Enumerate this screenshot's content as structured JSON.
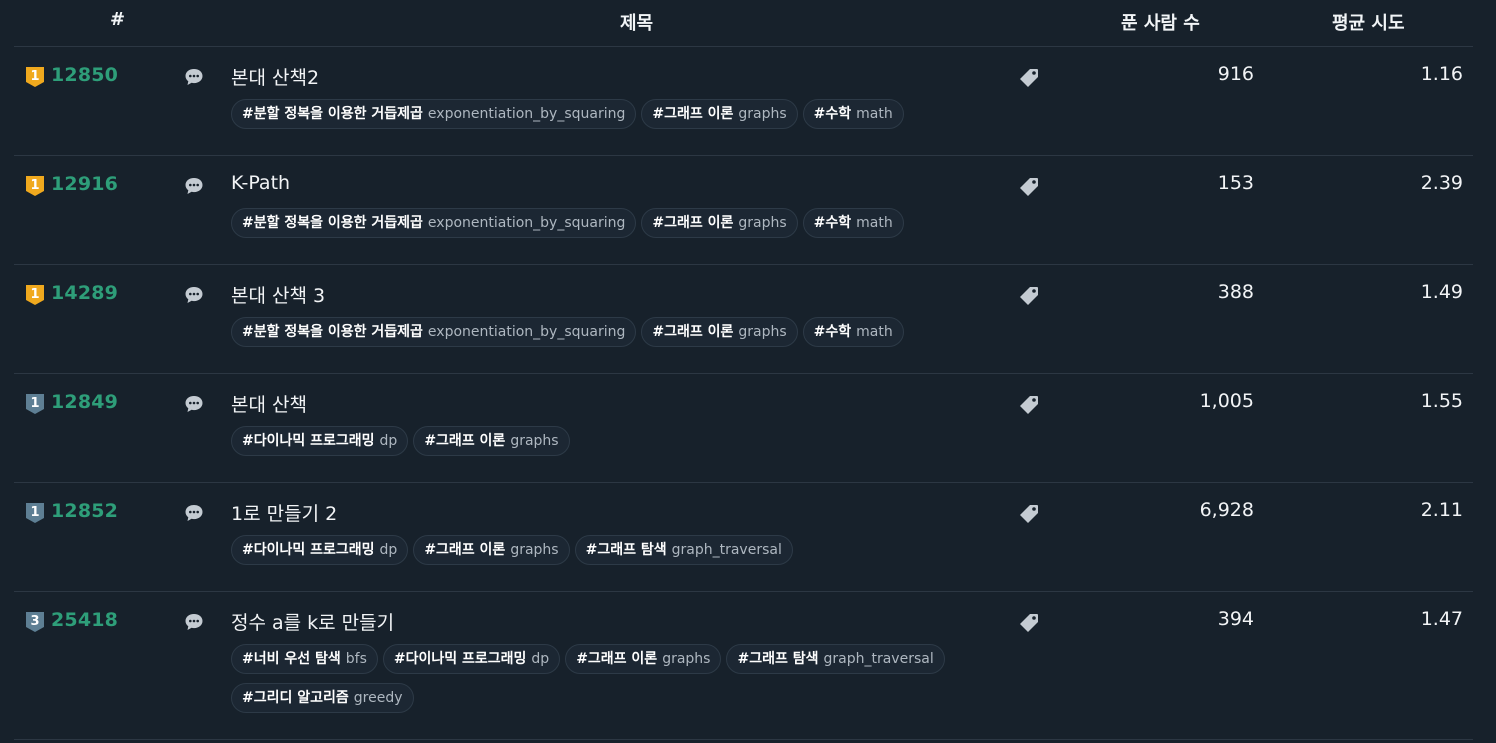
{
  "header": {
    "num": "#",
    "title": "제목",
    "solved": "푼 사람 수",
    "avg": "평균 시도"
  },
  "colors": {
    "gold": "#f0a91e",
    "silver": "#5e7f94",
    "id": "#2e9e79",
    "icon": "#c4cbd2"
  },
  "rows": [
    {
      "tier": "gold",
      "level": "1",
      "id": "12850",
      "title": "본대 산책2",
      "solved": "916",
      "avg": "1.16",
      "tags": [
        {
          "ko": "#분할 정복을 이용한 거듭제곱",
          "en": "exponentiation_by_squaring"
        },
        {
          "ko": "#그래프 이론",
          "en": "graphs"
        },
        {
          "ko": "#수학",
          "en": "math"
        }
      ]
    },
    {
      "tier": "gold",
      "level": "1",
      "id": "12916",
      "title": "K-Path",
      "solved": "153",
      "avg": "2.39",
      "tags": [
        {
          "ko": "#분할 정복을 이용한 거듭제곱",
          "en": "exponentiation_by_squaring"
        },
        {
          "ko": "#그래프 이론",
          "en": "graphs"
        },
        {
          "ko": "#수학",
          "en": "math"
        }
      ]
    },
    {
      "tier": "gold",
      "level": "1",
      "id": "14289",
      "title": "본대 산책 3",
      "solved": "388",
      "avg": "1.49",
      "tags": [
        {
          "ko": "#분할 정복을 이용한 거듭제곱",
          "en": "exponentiation_by_squaring"
        },
        {
          "ko": "#그래프 이론",
          "en": "graphs"
        },
        {
          "ko": "#수학",
          "en": "math"
        }
      ]
    },
    {
      "tier": "silver",
      "level": "1",
      "id": "12849",
      "title": "본대 산책",
      "solved": "1,005",
      "avg": "1.55",
      "tags": [
        {
          "ko": "#다이나믹 프로그래밍",
          "en": "dp"
        },
        {
          "ko": "#그래프 이론",
          "en": "graphs"
        }
      ]
    },
    {
      "tier": "silver",
      "level": "1",
      "id": "12852",
      "title": "1로 만들기 2",
      "solved": "6,928",
      "avg": "2.11",
      "tags": [
        {
          "ko": "#다이나믹 프로그래밍",
          "en": "dp"
        },
        {
          "ko": "#그래프 이론",
          "en": "graphs"
        },
        {
          "ko": "#그래프 탐색",
          "en": "graph_traversal"
        }
      ]
    },
    {
      "tier": "silver",
      "level": "3",
      "id": "25418",
      "title": "정수 a를 k로 만들기",
      "solved": "394",
      "avg": "1.47",
      "tags": [
        {
          "ko": "#너비 우선 탐색",
          "en": "bfs"
        },
        {
          "ko": "#다이나믹 프로그래밍",
          "en": "dp"
        },
        {
          "ko": "#그래프 이론",
          "en": "graphs"
        },
        {
          "ko": "#그래프 탐색",
          "en": "graph_traversal"
        },
        {
          "ko": "#그리디 알고리즘",
          "en": "greedy"
        }
      ]
    }
  ]
}
